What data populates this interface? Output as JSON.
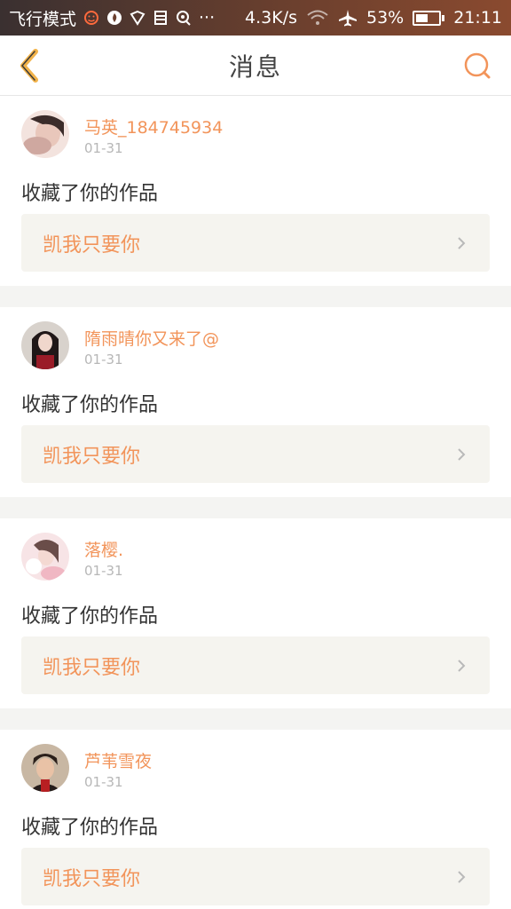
{
  "status_bar": {
    "mode": "飞行模式",
    "speed": "4.3K/s",
    "battery_pct": "53%",
    "battery_level": 0.53,
    "time": "21:11"
  },
  "nav": {
    "title": "消息"
  },
  "colors": {
    "accent": "#f2945a",
    "text_dark": "#333333",
    "muted": "#b7b7b7",
    "box_bg": "#f5f4ef"
  },
  "messages": [
    {
      "user": "马英_184745934",
      "date": "01-31",
      "action": "收藏了你的作品",
      "work": "凯我只要你",
      "avatar_color": "#e8cfc7"
    },
    {
      "user": "隋雨晴你又来了@",
      "date": "01-31",
      "action": "收藏了你的作品",
      "work": "凯我只要你",
      "avatar_color": "#3a2a2a"
    },
    {
      "user": "落樱.",
      "date": "01-31",
      "action": "收藏了你的作品",
      "work": "凯我只要你",
      "avatar_color": "#f1d3d8"
    },
    {
      "user": "芦苇雪夜",
      "date": "01-31",
      "action": "收藏了你的作品",
      "work": "凯我只要你",
      "avatar_color": "#5a4636"
    }
  ]
}
